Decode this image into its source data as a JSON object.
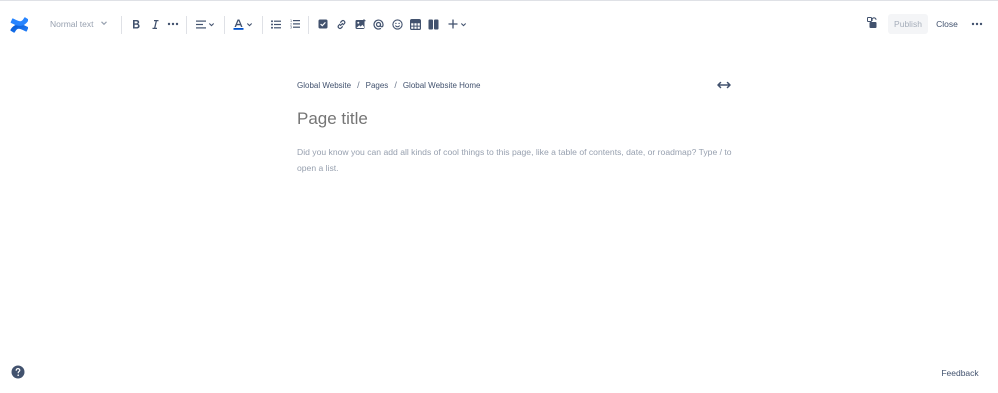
{
  "toolbar": {
    "text_style": "Normal text",
    "publish_label": "Publish",
    "close_label": "Close"
  },
  "icons": {
    "logo": "confluence-logo",
    "bold": "bold-icon",
    "italic": "italic-icon",
    "more_formatting": "more-formatting-icon",
    "alignment": "align-left-icon",
    "text_color": "text-color-icon",
    "bullet_list": "bullet-list-icon",
    "numbered_list": "numbered-list-icon",
    "action_item": "checkbox-icon",
    "link": "link-icon",
    "image": "image-icon",
    "mention": "mention-icon",
    "emoji": "emoji-icon",
    "table": "table-icon",
    "layouts": "layouts-icon",
    "insert": "plus-icon",
    "restrictions": "unlock-icon",
    "more": "more-icon",
    "full_width": "full-width-icon",
    "help": "help-icon"
  },
  "breadcrumb": {
    "items": [
      "Global Website",
      "Pages",
      "Global Website Home"
    ]
  },
  "page": {
    "title_placeholder": "Page title",
    "body_placeholder": "Did you know you can add all kinds of cool things to this page, like a table of contents, date, or roadmap? Type / to open a list."
  },
  "footer": {
    "feedback_label": "Feedback"
  },
  "colors": {
    "brand_blue": "#1868db",
    "text_primary": "#42526e",
    "placeholder": "#97a0af",
    "text_color_accent": "#0052cc"
  }
}
